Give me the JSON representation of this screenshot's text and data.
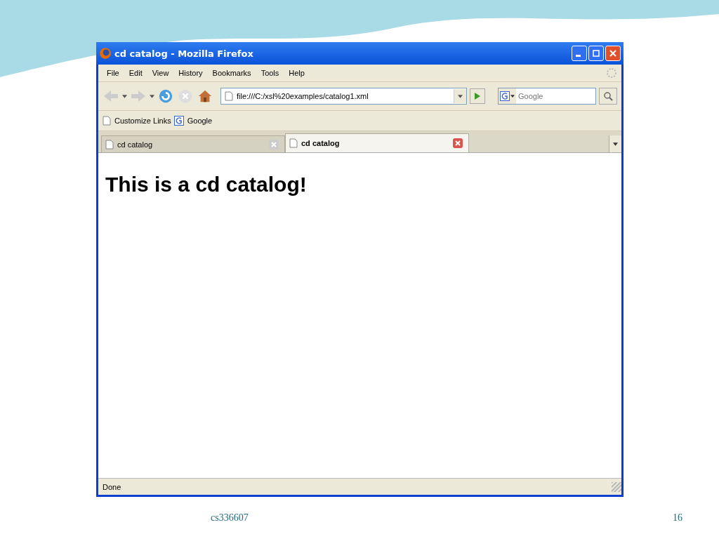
{
  "window": {
    "title": "cd catalog - Mozilla Firefox"
  },
  "menu": [
    {
      "label": "File"
    },
    {
      "label": "Edit"
    },
    {
      "label": "View"
    },
    {
      "label": "History"
    },
    {
      "label": "Bookmarks"
    },
    {
      "label": "Tools"
    },
    {
      "label": "Help"
    }
  ],
  "address_bar": {
    "value": "file:///C:/xsl%20examples/catalog1.xml"
  },
  "search": {
    "placeholder": "Google"
  },
  "bookmarks": [
    {
      "label": "Customize Links",
      "kind": "page"
    },
    {
      "label": "Google",
      "kind": "google"
    }
  ],
  "tabs": [
    {
      "label": "cd catalog",
      "selected": false
    },
    {
      "label": "cd catalog",
      "selected": true
    }
  ],
  "page": {
    "heading": "This is a cd catalog!"
  },
  "status_bar": {
    "text": "Done"
  },
  "slide_footer": {
    "course": "cs336607",
    "page_number": "16"
  }
}
